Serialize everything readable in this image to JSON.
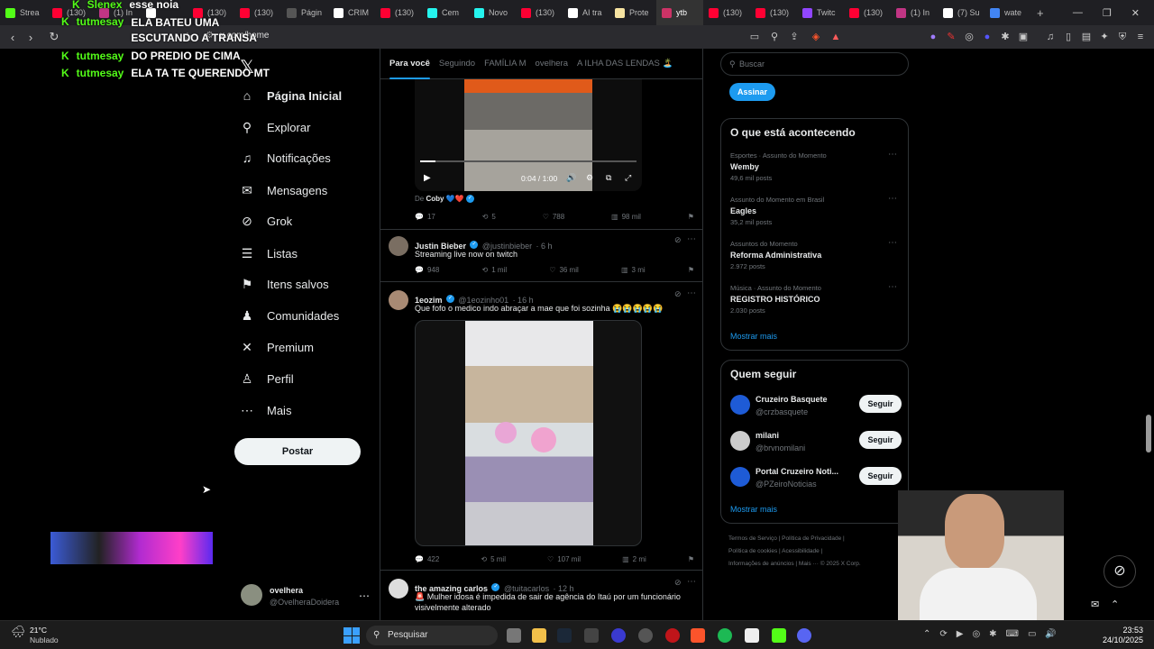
{
  "browser": {
    "tabs": [
      {
        "label": "Strea",
        "color": "#53fc18"
      },
      {
        "label": "(130)",
        "color": "#ff0033"
      },
      {
        "label": "(1) In",
        "color": "#c13584"
      },
      {
        "label": "",
        "color": "#ffffff"
      },
      {
        "label": "(130)",
        "color": "#ff0033"
      },
      {
        "label": "(130)",
        "color": "#ff0033"
      },
      {
        "label": "Págin",
        "color": "#555555"
      },
      {
        "label": "CRIM",
        "color": "#ffffff"
      },
      {
        "label": "(130)",
        "color": "#ff0033"
      },
      {
        "label": "Cem",
        "color": "#25f4ee"
      },
      {
        "label": "Novo",
        "color": "#25f4ee"
      },
      {
        "label": "(130)",
        "color": "#ff0033"
      },
      {
        "label": "AI tra",
        "color": "#ffffff"
      },
      {
        "label": "Prote",
        "color": "#f6e3a1"
      },
      {
        "label": "ytb",
        "color": "#cc3366"
      },
      {
        "label": "(130)",
        "color": "#ff0033"
      },
      {
        "label": "(130)",
        "color": "#ff0033"
      },
      {
        "label": "Twitc",
        "color": "#9146ff"
      },
      {
        "label": "(130)",
        "color": "#ff0033"
      },
      {
        "label": "(1) In",
        "color": "#c13584"
      },
      {
        "label": "(7) Su",
        "color": "#ffffff"
      },
      {
        "label": "wate",
        "color": "#4285f4"
      }
    ],
    "new_tab": "+",
    "url": "x.com/home",
    "controls": {
      "min": "—",
      "max": "❐",
      "close": "✕"
    }
  },
  "chat": [
    {
      "user": "Slenex",
      "msg": "esse noia"
    },
    {
      "user": "tutmesay",
      "msg": "ELA BATEU UMA ESCUTANDO A TRANSA"
    },
    {
      "user": "tutmesay",
      "msg": "DO PREDIO DE CIMA"
    },
    {
      "user": "tutmesay",
      "msg": "ELA TA TE QUERENDO MT"
    }
  ],
  "nav": {
    "logo": "𝕏",
    "items": [
      {
        "label": "Página Inicial",
        "icon": "home-icon",
        "glyph": "⌂"
      },
      {
        "label": "Explorar",
        "icon": "search-icon",
        "glyph": "⚲"
      },
      {
        "label": "Notificações",
        "icon": "bell-icon",
        "glyph": "♫"
      },
      {
        "label": "Mensagens",
        "icon": "mail-icon",
        "glyph": "✉"
      },
      {
        "label": "Grok",
        "icon": "grok-icon",
        "glyph": "⊘"
      },
      {
        "label": "Listas",
        "icon": "list-icon",
        "glyph": "☰"
      },
      {
        "label": "Itens salvos",
        "icon": "bookmark-icon",
        "glyph": "⚑"
      },
      {
        "label": "Comunidades",
        "icon": "people-icon",
        "glyph": "♟"
      },
      {
        "label": "Premium",
        "icon": "x-icon",
        "glyph": "✕"
      },
      {
        "label": "Perfil",
        "icon": "user-icon",
        "glyph": "♙"
      },
      {
        "label": "Mais",
        "icon": "more-icon",
        "glyph": "⋯"
      }
    ],
    "post_button": "Postar",
    "account": {
      "name": "ovelhera",
      "handle": "@OvelheraDoidera",
      "more": "⋯"
    }
  },
  "feed": {
    "tabs": [
      "Para você",
      "Seguindo",
      "FAMÍLIA M",
      "ovelhera",
      "A ILHA DAS LENDAS 🏝️"
    ],
    "video": {
      "time": "0:04 / 1:00",
      "progress": 0.07
    },
    "tweet0": {
      "credit_prefix": "De",
      "credit": "Coby 💙❤️",
      "replies": "17",
      "reposts": "5",
      "likes": "788",
      "views": "98 mil"
    },
    "tweets": [
      {
        "name": "Justin Bieber",
        "handle": "@justinbieber",
        "time": "· 6 h",
        "text": "Streaming live now on twitch",
        "replies": "948",
        "reposts": "1 mil",
        "likes": "36 mil",
        "views": "3 mi"
      },
      {
        "name": "1eozim",
        "handle": "@1eozinho01",
        "time": "· 16 h",
        "text": "Que fofo o medico indo abraçar a mae que foi sozinha 😭😭😭😭😭",
        "replies": "422",
        "reposts": "5 mil",
        "likes": "107 mil",
        "views": "2 mi"
      },
      {
        "name": "the amazing carlos",
        "handle": "@tuitacarlos",
        "time": "· 12 h",
        "text": "🚨 Mulher idosa é impedida de sair de agência do Itaú por um funcionário visivelmente alterado"
      }
    ]
  },
  "right": {
    "search_placeholder": "Buscar",
    "subscribe": "Assinar",
    "trending_title": "O que está acontecendo",
    "trends": [
      {
        "context": "Esportes · Assunto do Momento",
        "title": "Wemby",
        "posts": "49,6 mil posts"
      },
      {
        "context": "Assunto do Momento em Brasil",
        "title": "Eagles",
        "posts": "35,2 mil posts"
      },
      {
        "context": "Assuntos do Momento",
        "title": "Reforma Administrativa",
        "posts": "2.972 posts"
      },
      {
        "context": "Música · Assunto do Momento",
        "title": "REGISTRO HISTÓRICO",
        "posts": "2.030 posts"
      }
    ],
    "show_more": "Mostrar mais",
    "who_to_follow_title": "Quem seguir",
    "follows": [
      {
        "name": "Cruzeiro Basquete",
        "handle": "@crzbasquete",
        "button": "Seguir"
      },
      {
        "name": "milani",
        "handle": "@brvnomilani",
        "button": "Seguir"
      },
      {
        "name": "Portal Cruzeiro Noti...",
        "handle": "@PZeiroNoticias",
        "button": "Seguir"
      }
    ],
    "show_more2": "Mostrar mais",
    "footer1": "Termos de Serviço  |  Política de Privacidade  |",
    "footer2": "Política de cookies  |  Acessibilidade  |",
    "footer3": "Informações de anúncios  |  Mais ···  © 2025 X Corp."
  },
  "taskbar": {
    "weather_temp": "21°C",
    "weather_desc": "Nublado",
    "search": "Pesquisar",
    "time": "23:53",
    "date": "24/10/2025"
  }
}
